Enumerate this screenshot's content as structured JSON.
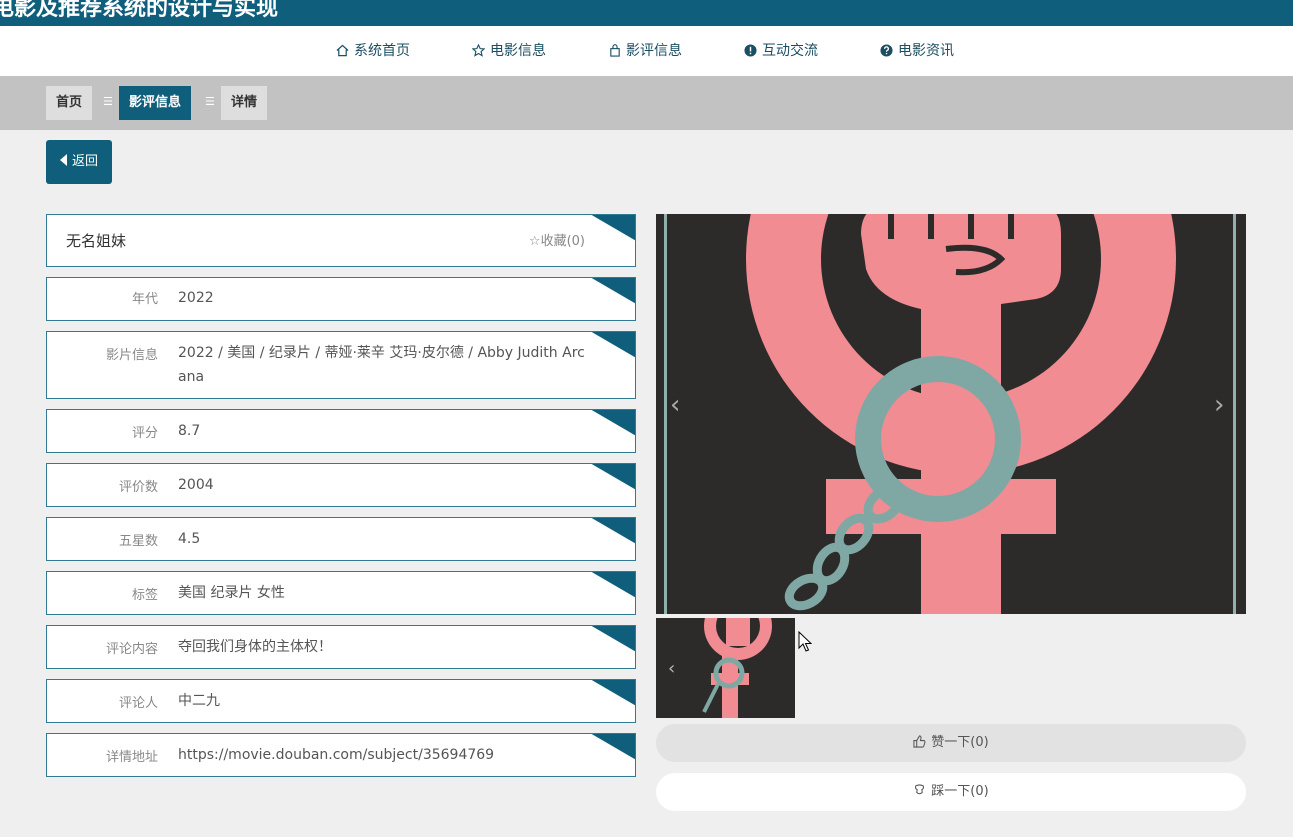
{
  "header": {
    "site_title": "电影及推荐系统的设计与实现"
  },
  "nav": [
    {
      "label": "系统首页",
      "icon": "home-icon"
    },
    {
      "label": "电影信息",
      "icon": "star-icon"
    },
    {
      "label": "影评信息",
      "icon": "bag-icon"
    },
    {
      "label": "互动交流",
      "icon": "exclamation-icon"
    },
    {
      "label": "电影资讯",
      "icon": "question-icon"
    }
  ],
  "breadcrumb": {
    "home": "首页",
    "current": "影评信息",
    "detail": "详情"
  },
  "back_button": "返回",
  "movie": {
    "title": "无名姐妹",
    "favorite": "☆收藏(0)"
  },
  "fields": [
    {
      "label": "年代",
      "value": "2022"
    },
    {
      "label": "影片信息",
      "value": "2022 / 美国 / 纪录片 / 蒂娅·莱辛 艾玛·皮尔德 / Abby Judith Arcana"
    },
    {
      "label": "评分",
      "value": "8.7"
    },
    {
      "label": "评价数",
      "value": "2004"
    },
    {
      "label": "五星数",
      "value": "4.5"
    },
    {
      "label": "标签",
      "value": "美国 纪录片 女性"
    },
    {
      "label": "评论内容",
      "value": "夺回我们身体的主体权！"
    },
    {
      "label": "评论人",
      "value": "中二九"
    },
    {
      "label": "详情地址",
      "value": "https://movie.douban.com/subject/35694769"
    }
  ],
  "actions": {
    "like": "赞一下(0)",
    "dislike": "踩一下(0)"
  },
  "colors": {
    "primary": "#0f5f7c",
    "background": "#efefef",
    "poster_pink": "#f08c92",
    "poster_teal": "#7fa8a4"
  }
}
